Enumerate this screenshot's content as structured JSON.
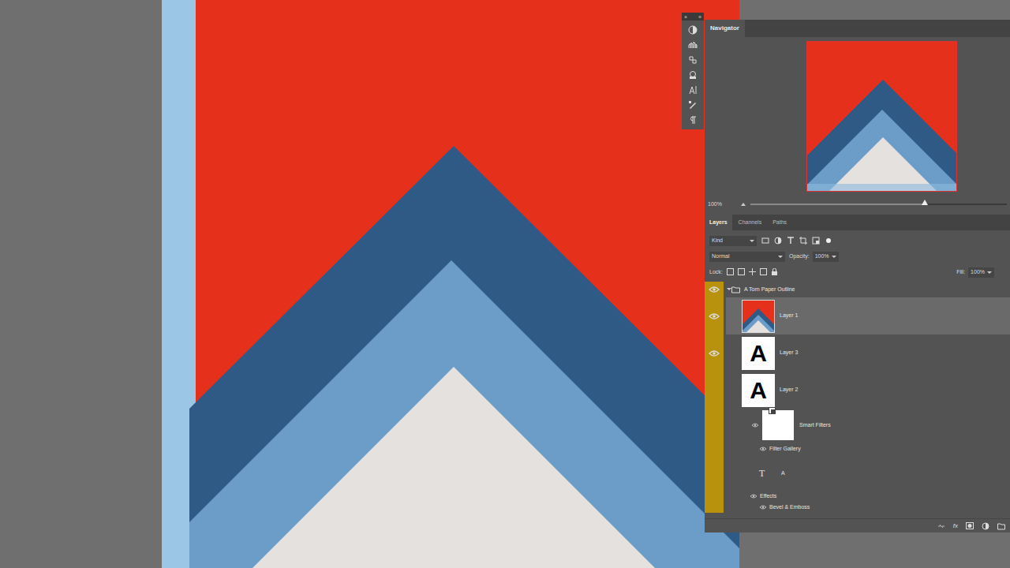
{
  "panel_controls": [
    "×",
    "»"
  ],
  "navigator": {
    "title": "Navigator",
    "zoom": "100%",
    "zoom_level": 0.68
  },
  "layers_panel": {
    "tabs": [
      {
        "label": "Layers",
        "selected": true
      },
      {
        "label": "Channels",
        "selected": false
      },
      {
        "label": "Paths",
        "selected": false
      }
    ],
    "filter": "Kind",
    "blend_mode": "Normal",
    "opacity_label": "Opacity:",
    "opacity": "100%",
    "lock_label": "Lock:",
    "fill_label": "Fill:",
    "fill": "100%",
    "layers": [
      {
        "name": "A Torn Paper Outline",
        "kind": "group",
        "visible": true,
        "selected": false,
        "expanded": true
      },
      {
        "name": "Layer 1",
        "kind": "pixel",
        "visible": true,
        "selected": true
      },
      {
        "name": "Layer 3",
        "kind": "smarttext",
        "visible": true,
        "selected": false,
        "thumb": "A",
        "smart": false
      },
      {
        "name": "Layer 2",
        "kind": "smarttext",
        "visible": false,
        "selected": false,
        "thumb": "A",
        "smart": true
      },
      {
        "name": "Smart Filters",
        "kind": "smartfilters",
        "visible": true,
        "selected": false
      },
      {
        "name": "Filter Gallery",
        "kind": "filter",
        "visible": true,
        "selected": false
      },
      {
        "name": "A",
        "kind": "text",
        "glyph": "T",
        "visible": false,
        "selected": false
      },
      {
        "name": "Effects",
        "kind": "effects",
        "visible": true,
        "selected": false
      },
      {
        "name": "Bevel & Emboss",
        "kind": "effect",
        "visible": true,
        "selected": false
      }
    ],
    "footer_fx": "fx"
  }
}
